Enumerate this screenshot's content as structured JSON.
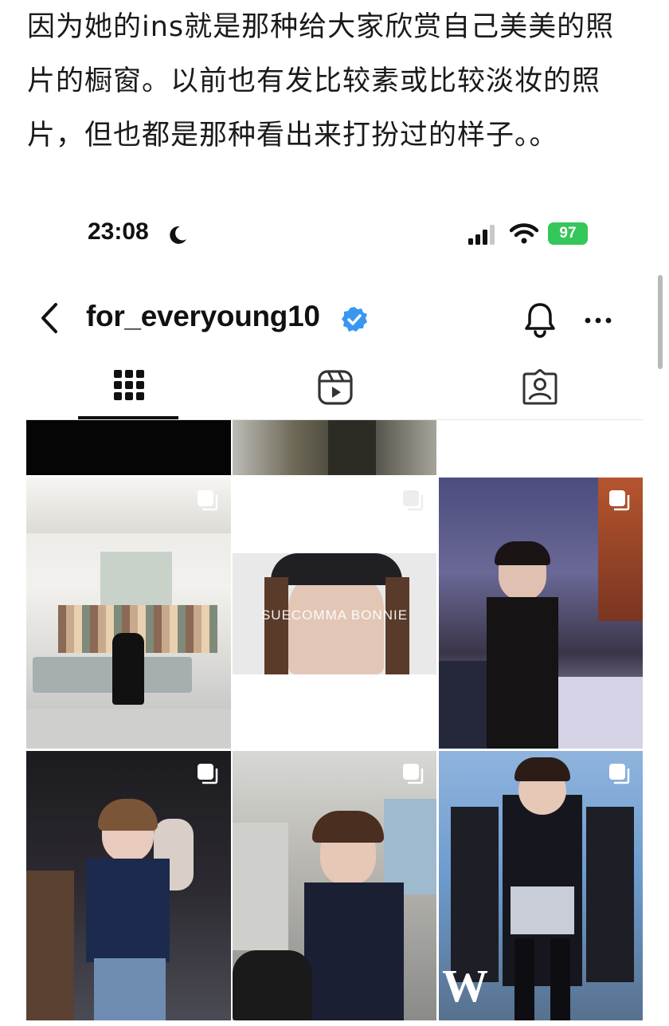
{
  "post": {
    "lines": [
      "因为她的ins就是那种给大家欣赏自己美美的照",
      "片的橱窗。以前也有发比较素或比较淡妆的照",
      "片，但也都是那种看出来打扮过的样子。。"
    ]
  },
  "status_bar": {
    "time": "23:08",
    "battery": "97"
  },
  "profile_header": {
    "username": "for_everyoung10"
  },
  "grid": {
    "tile_texts": {
      "bonnie": "SUECOMMA BONNIE",
      "w": "W"
    }
  },
  "icons": [
    "back-icon",
    "verified-icon",
    "bell-icon",
    "more-icon",
    "grid-icon",
    "reels-icon",
    "tagged-icon",
    "moon-icon",
    "signal-icon",
    "wifi-icon",
    "carousel-icon"
  ],
  "colors": {
    "verified": "#3897f0",
    "battery": "#34c759",
    "text": "#111111"
  }
}
